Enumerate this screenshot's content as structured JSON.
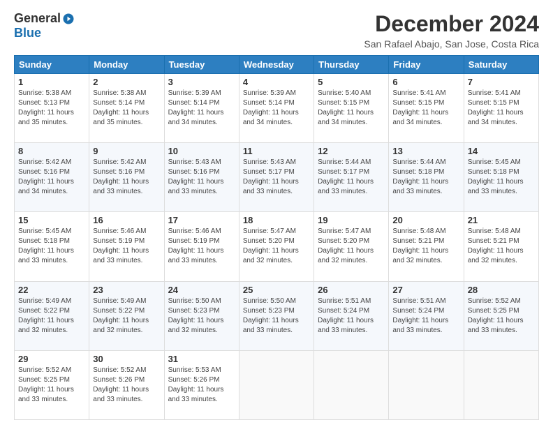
{
  "header": {
    "logo_general": "General",
    "logo_blue": "Blue",
    "month_title": "December 2024",
    "location": "San Rafael Abajo, San Jose, Costa Rica"
  },
  "days_of_week": [
    "Sunday",
    "Monday",
    "Tuesday",
    "Wednesday",
    "Thursday",
    "Friday",
    "Saturday"
  ],
  "weeks": [
    [
      {
        "day": "1",
        "sunrise": "5:38 AM",
        "sunset": "5:13 PM",
        "daylight": "11 hours and 35 minutes."
      },
      {
        "day": "2",
        "sunrise": "5:38 AM",
        "sunset": "5:14 PM",
        "daylight": "11 hours and 35 minutes."
      },
      {
        "day": "3",
        "sunrise": "5:39 AM",
        "sunset": "5:14 PM",
        "daylight": "11 hours and 34 minutes."
      },
      {
        "day": "4",
        "sunrise": "5:39 AM",
        "sunset": "5:14 PM",
        "daylight": "11 hours and 34 minutes."
      },
      {
        "day": "5",
        "sunrise": "5:40 AM",
        "sunset": "5:15 PM",
        "daylight": "11 hours and 34 minutes."
      },
      {
        "day": "6",
        "sunrise": "5:41 AM",
        "sunset": "5:15 PM",
        "daylight": "11 hours and 34 minutes."
      },
      {
        "day": "7",
        "sunrise": "5:41 AM",
        "sunset": "5:15 PM",
        "daylight": "11 hours and 34 minutes."
      }
    ],
    [
      {
        "day": "8",
        "sunrise": "5:42 AM",
        "sunset": "5:16 PM",
        "daylight": "11 hours and 34 minutes."
      },
      {
        "day": "9",
        "sunrise": "5:42 AM",
        "sunset": "5:16 PM",
        "daylight": "11 hours and 33 minutes."
      },
      {
        "day": "10",
        "sunrise": "5:43 AM",
        "sunset": "5:16 PM",
        "daylight": "11 hours and 33 minutes."
      },
      {
        "day": "11",
        "sunrise": "5:43 AM",
        "sunset": "5:17 PM",
        "daylight": "11 hours and 33 minutes."
      },
      {
        "day": "12",
        "sunrise": "5:44 AM",
        "sunset": "5:17 PM",
        "daylight": "11 hours and 33 minutes."
      },
      {
        "day": "13",
        "sunrise": "5:44 AM",
        "sunset": "5:18 PM",
        "daylight": "11 hours and 33 minutes."
      },
      {
        "day": "14",
        "sunrise": "5:45 AM",
        "sunset": "5:18 PM",
        "daylight": "11 hours and 33 minutes."
      }
    ],
    [
      {
        "day": "15",
        "sunrise": "5:45 AM",
        "sunset": "5:18 PM",
        "daylight": "11 hours and 33 minutes."
      },
      {
        "day": "16",
        "sunrise": "5:46 AM",
        "sunset": "5:19 PM",
        "daylight": "11 hours and 33 minutes."
      },
      {
        "day": "17",
        "sunrise": "5:46 AM",
        "sunset": "5:19 PM",
        "daylight": "11 hours and 33 minutes."
      },
      {
        "day": "18",
        "sunrise": "5:47 AM",
        "sunset": "5:20 PM",
        "daylight": "11 hours and 32 minutes."
      },
      {
        "day": "19",
        "sunrise": "5:47 AM",
        "sunset": "5:20 PM",
        "daylight": "11 hours and 32 minutes."
      },
      {
        "day": "20",
        "sunrise": "5:48 AM",
        "sunset": "5:21 PM",
        "daylight": "11 hours and 32 minutes."
      },
      {
        "day": "21",
        "sunrise": "5:48 AM",
        "sunset": "5:21 PM",
        "daylight": "11 hours and 32 minutes."
      }
    ],
    [
      {
        "day": "22",
        "sunrise": "5:49 AM",
        "sunset": "5:22 PM",
        "daylight": "11 hours and 32 minutes."
      },
      {
        "day": "23",
        "sunrise": "5:49 AM",
        "sunset": "5:22 PM",
        "daylight": "11 hours and 32 minutes."
      },
      {
        "day": "24",
        "sunrise": "5:50 AM",
        "sunset": "5:23 PM",
        "daylight": "11 hours and 32 minutes."
      },
      {
        "day": "25",
        "sunrise": "5:50 AM",
        "sunset": "5:23 PM",
        "daylight": "11 hours and 33 minutes."
      },
      {
        "day": "26",
        "sunrise": "5:51 AM",
        "sunset": "5:24 PM",
        "daylight": "11 hours and 33 minutes."
      },
      {
        "day": "27",
        "sunrise": "5:51 AM",
        "sunset": "5:24 PM",
        "daylight": "11 hours and 33 minutes."
      },
      {
        "day": "28",
        "sunrise": "5:52 AM",
        "sunset": "5:25 PM",
        "daylight": "11 hours and 33 minutes."
      }
    ],
    [
      {
        "day": "29",
        "sunrise": "5:52 AM",
        "sunset": "5:25 PM",
        "daylight": "11 hours and 33 minutes."
      },
      {
        "day": "30",
        "sunrise": "5:52 AM",
        "sunset": "5:26 PM",
        "daylight": "11 hours and 33 minutes."
      },
      {
        "day": "31",
        "sunrise": "5:53 AM",
        "sunset": "5:26 PM",
        "daylight": "11 hours and 33 minutes."
      },
      null,
      null,
      null,
      null
    ]
  ]
}
